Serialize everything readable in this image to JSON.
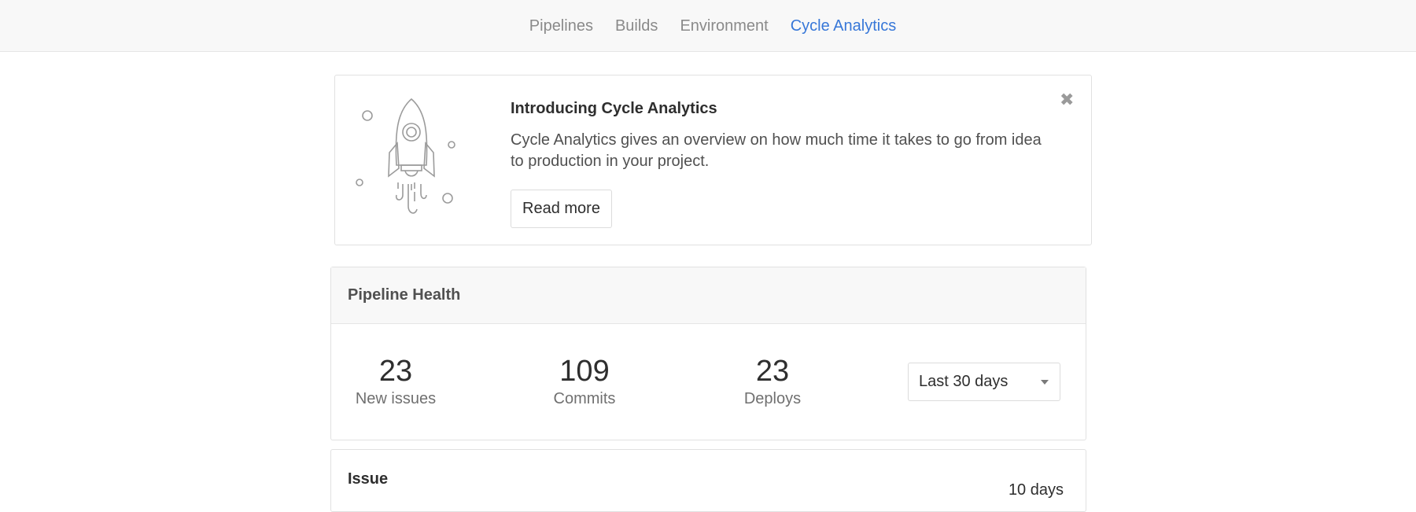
{
  "nav": {
    "tabs": [
      {
        "label": "Pipelines"
      },
      {
        "label": "Builds"
      },
      {
        "label": "Environment"
      },
      {
        "label": "Cycle Analytics"
      }
    ],
    "active_color": "#3777d8"
  },
  "intro": {
    "title": "Introducing Cycle Analytics",
    "description": "Cycle Analytics gives an overview on how much time it takes to go from idea to production in your project.",
    "read_more_label": "Read more",
    "close_icon": "close-icon"
  },
  "pipeline_health": {
    "heading": "Pipeline Health",
    "stats": [
      {
        "value": "23",
        "label": "New issues"
      },
      {
        "value": "109",
        "label": "Commits"
      },
      {
        "value": "23",
        "label": "Deploys"
      }
    ],
    "period_select": {
      "selected": "Last 30 days"
    }
  },
  "stages": {
    "issue_title": "Issue",
    "issue_value": "10 days"
  }
}
